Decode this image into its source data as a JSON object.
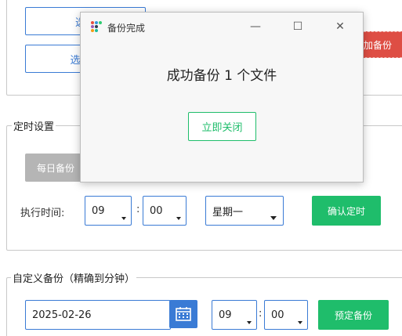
{
  "top": {
    "btn1_label": "选择",
    "btn2_label": "选择目",
    "red_label": "加备份"
  },
  "dialog": {
    "title": "备份完成",
    "message": "成功备份 1 个文件",
    "close_button": "立即关闭",
    "minimize_glyph": "—",
    "maximize_glyph": "☐",
    "close_glyph": "✕"
  },
  "schedule": {
    "legend": "定时设置",
    "daily_button": "每日备份",
    "exec_label": "执行时间:",
    "hour": "09",
    "minute": "00",
    "colon": ":",
    "weekday": "星期一",
    "confirm_button": "确认定时"
  },
  "custom": {
    "legend": "自定义备份（精确到分钟）",
    "date": "2025-02-26",
    "hour": "09",
    "minute": "00",
    "colon": ":",
    "schedule_button": "预定备份"
  },
  "colors": {
    "accent": "#3a7bd5",
    "green": "#1fbd6b",
    "red": "#de4e44",
    "gray_button": "#b5b5b5"
  }
}
